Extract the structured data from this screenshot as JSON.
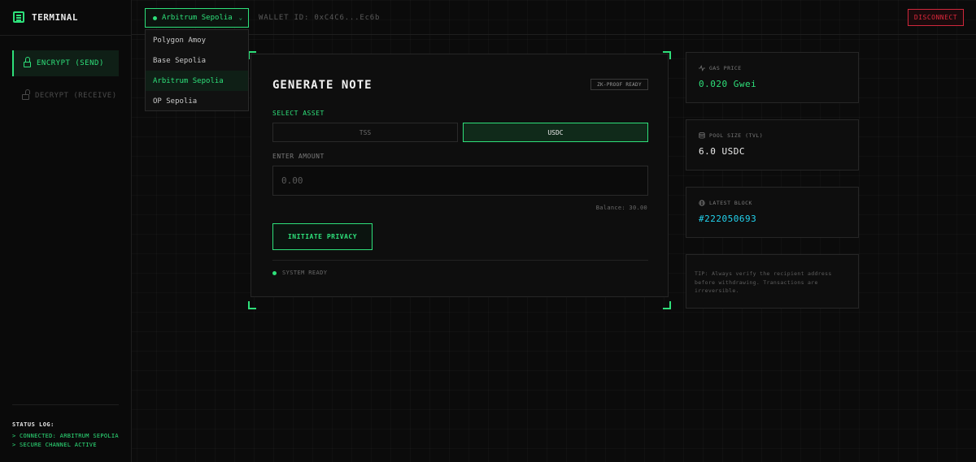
{
  "sidebar": {
    "brand": "TERMINAL",
    "nav": [
      {
        "label": "ENCRYPT (SEND)",
        "active": true
      },
      {
        "label": "DECRYPT (RECEIVE)",
        "active": false
      }
    ],
    "status_log": {
      "title": "STATUS LOG:",
      "lines": [
        "> CONNECTED: ARBITRUM SEPOLIA",
        "> SECURE CHANNEL ACTIVE"
      ]
    }
  },
  "topbar": {
    "network_selected": "Arbitrum Sepolia",
    "wallet_label": "WALLET ID: 0xC4C6...Ec6b",
    "disconnect_label": "DISCONNECT"
  },
  "network_dropdown": {
    "options": [
      "Polygon Amoy",
      "Base Sepolia",
      "Arbitrum Sepolia",
      "OP Sepolia"
    ],
    "selected": "Arbitrum Sepolia"
  },
  "card": {
    "title": "GENERATE NOTE",
    "badge": "ZK-PROOF READY",
    "asset_label": "SELECT ASSET",
    "assets": [
      "TSS",
      "USDC"
    ],
    "selected_asset": "USDC",
    "amount_label": "ENTER AMOUNT",
    "amount_placeholder": "0.00",
    "balance": "Balance: 30.00",
    "action_label": "INITIATE PRIVACY",
    "system_status": "SYSTEM READY"
  },
  "stats": {
    "gas": {
      "label": "GAS PRICE",
      "value": "0.020 Gwei"
    },
    "pool": {
      "label": "POOL SIZE (TVL)",
      "value": "6.0 USDC"
    },
    "block": {
      "label": "LATEST BLOCK",
      "value": "#222050693"
    }
  },
  "tip": "TIP: Always verify the recipient address before withdrawing. Transactions are irreversible.",
  "colors": {
    "accent": "#2ee07a",
    "danger": "#e0283c",
    "cyan": "#22d3ee",
    "background": "#0b0b0b"
  }
}
